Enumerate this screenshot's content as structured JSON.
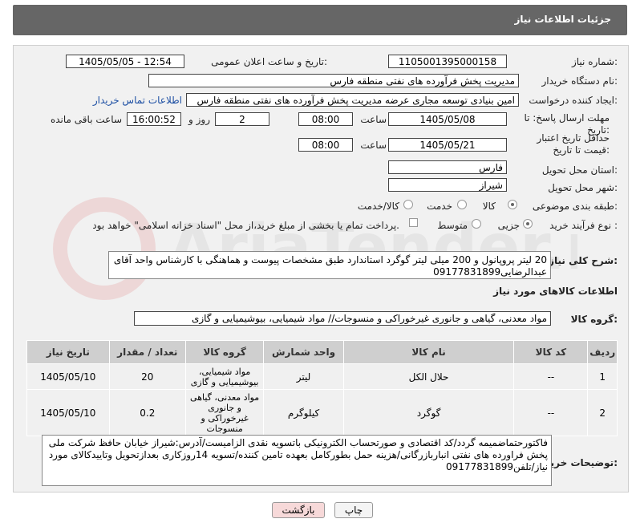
{
  "header": {
    "title": "جزئیات اطلاعات نیاز"
  },
  "form": {
    "need_number_label": "شماره نیاز:",
    "need_number": "1105001395000158",
    "announce_label": "تاریخ و ساعت اعلان عمومی:",
    "announce_value": "1405/05/05 - 12:54",
    "buyer_org_label": "نام دستگاه خریدار:",
    "buyer_org": "مدیریت پخش فرآورده های نفتی منطقه فارس",
    "requester_label": "ایجاد کننده درخواست:",
    "requester": "امین بنیادی توسعه مجاری عرضه مدیریت پخش فرآورده های نفتی منطقه فارس",
    "contact_link": "اطلاعات تماس خریدار",
    "reply_deadline_label": "مهلت ارسال پاسخ: تا تاریخ:",
    "reply_date": "1405/05/08",
    "time_label": "ساعت",
    "reply_time": "08:00",
    "days_value": "2",
    "days_label": "روز و",
    "remaining_time": "16:00:52",
    "remaining_label": "ساعت باقی مانده",
    "validity_label": "حداقل تاریخ اعتبار قیمت تا تاریخ:",
    "validity_date": "1405/05/21",
    "validity_time": "08:00",
    "province_label": "استان محل تحویل:",
    "province": "فارس",
    "city_label": "شهر محل تحویل:",
    "city": "شیراز",
    "category_label": "طبقه بندی موضوعی:",
    "category_options": [
      "کالا",
      "خدمت",
      "کالا/خدمت"
    ],
    "process_label": "نوع فرآیند خرید :",
    "process_options": [
      "جزیی",
      "متوسط"
    ],
    "process_note": "پرداخت تمام یا بخشی از مبلغ خرید،از محل \"اسناد خزانه اسلامی\" خواهد بود."
  },
  "description": {
    "label": "شرح کلی نیاز:",
    "text": "20 لیتر پروپانول و 200 میلی لیتر گوگرد استاندارد طبق مشخصات پیوست و هماهنگی با کارشناس واحد آقای عبدالرضایی09177831899"
  },
  "goods_section": {
    "title": "اطلاعات کالاهای مورد نیاز",
    "group_label": "گروه کالا:",
    "group_value": "مواد معدنی، گیاهی و جانوری غیرخوراکی و منسوجات// مواد شیمیایی، بیوشیمیایی و  گازی"
  },
  "table": {
    "headers": [
      "ردیف",
      "کد کالا",
      "نام کالا",
      "واحد شمارش",
      "گروه کالا",
      "تعداد / مقدار",
      "تاریخ نیاز"
    ],
    "rows": [
      [
        "1",
        "--",
        "حلال الکل",
        "لیتر",
        "مواد شیمیایی، بیوشیمیایی و گازی",
        "20",
        "1405/05/10"
      ],
      [
        "2",
        "--",
        "گوگرد",
        "کیلوگرم",
        "مواد معدنی، گیاهی و جانوری غیرخوراکی و منسوجات",
        "0.2",
        "1405/05/10"
      ]
    ]
  },
  "buyer_notes": {
    "label": "توضیحات خریدار:",
    "text": "فاکتورحتماضمیمه گردد/کد اقتصادی و صورتحساب الکترونیکی باتسویه نقدی الزامیست/آدرس:شیراز خیابان حافظ شرکت ملی پخش فراورده های نفتی انباربازرگانی/هزینه حمل بطورکامل بعهده تامین کننده/تسویه 14روزکاری بعدازتحویل وتاییدکالای مورد نیاز/تلفن09177831899"
  },
  "buttons": {
    "print": "چاپ",
    "back": "بازگشت"
  },
  "watermark": {
    "text": "AriaTender.net"
  }
}
